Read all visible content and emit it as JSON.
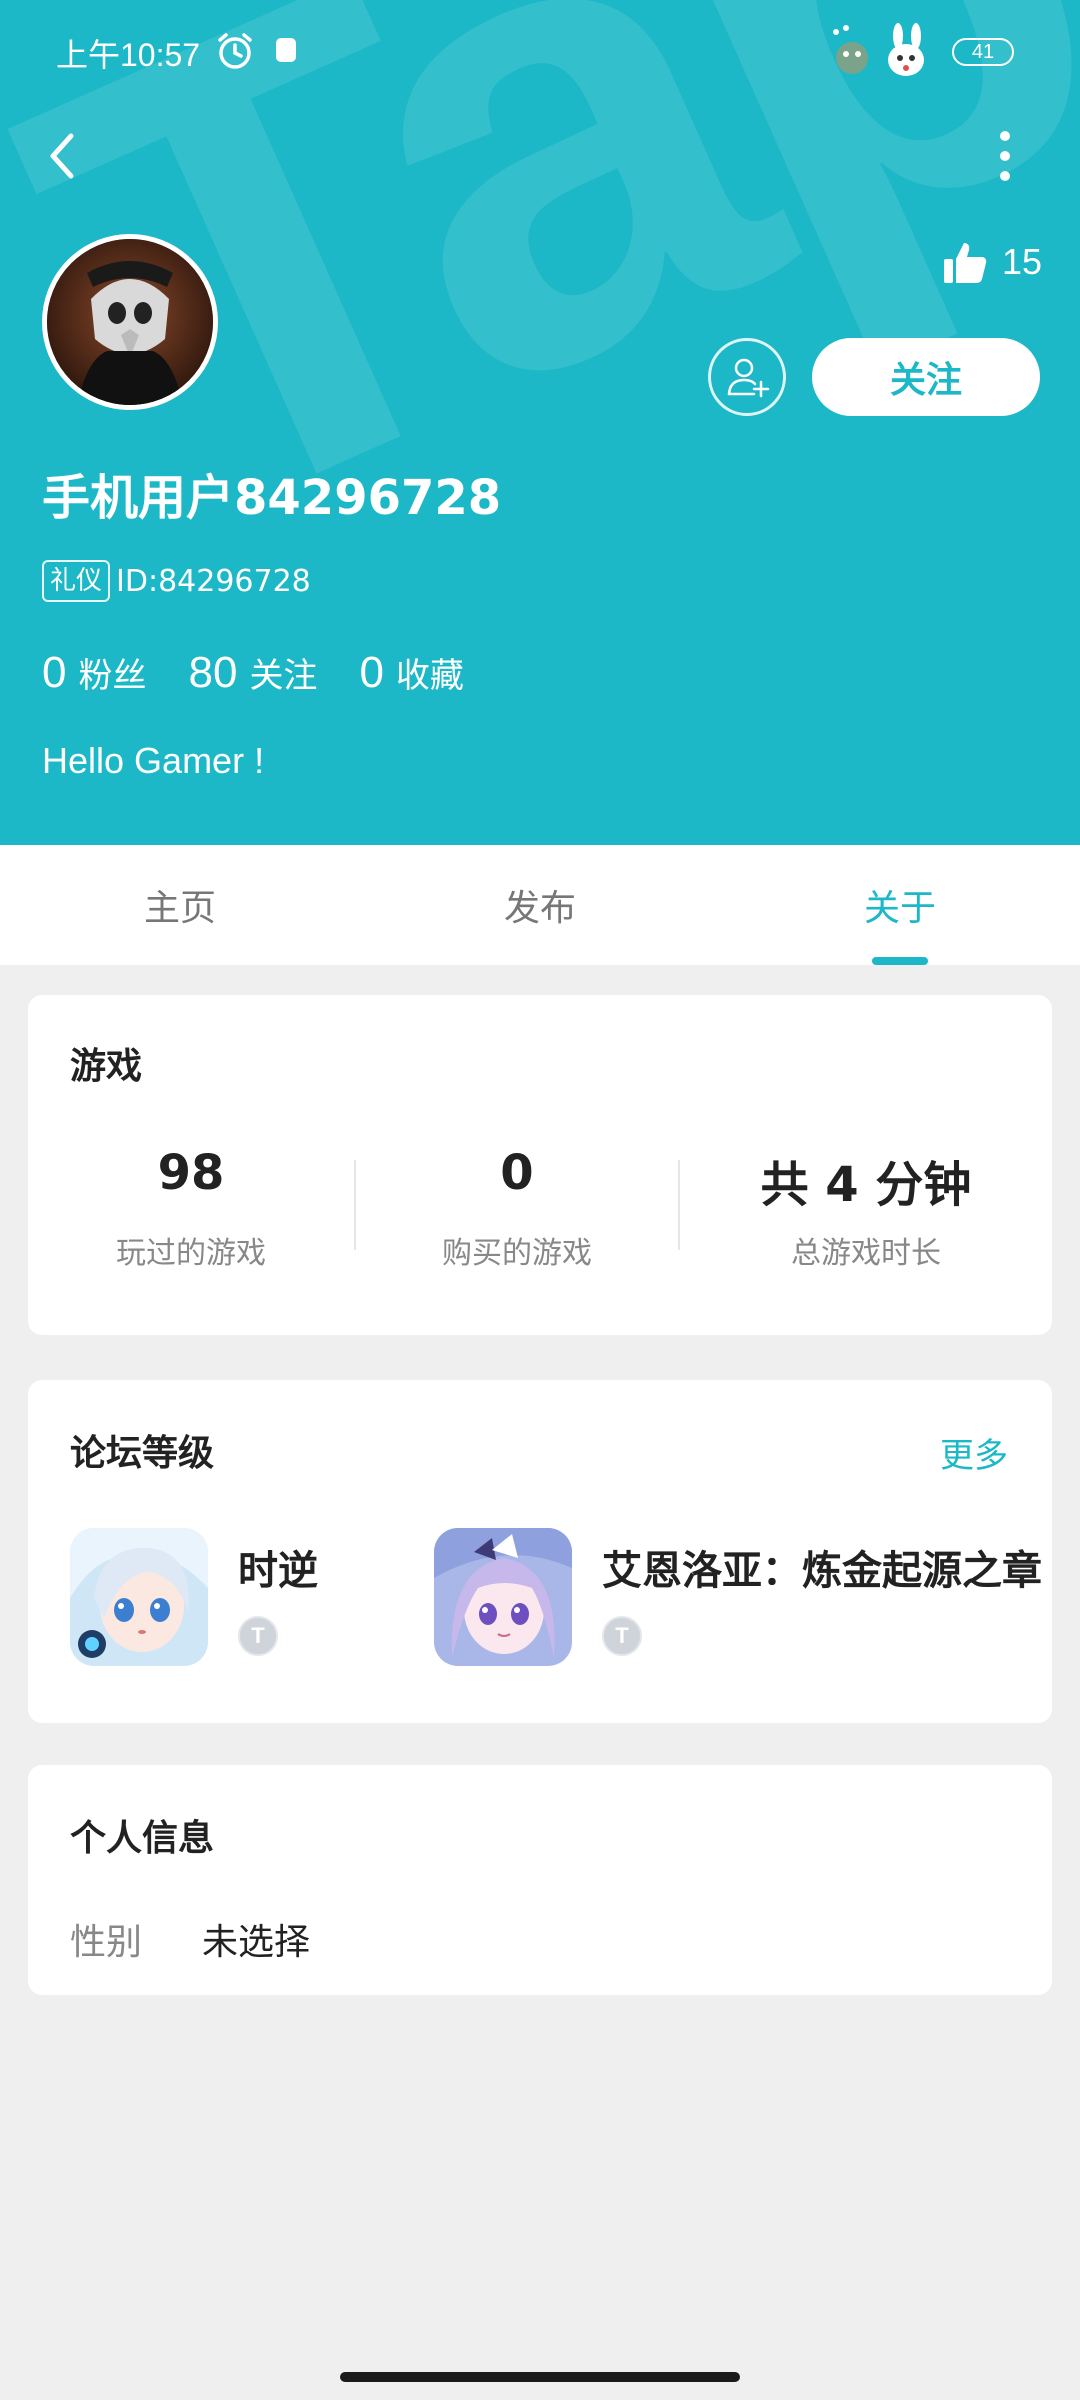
{
  "status_bar": {
    "time": "上午10:57",
    "battery": "41",
    "icons": [
      "alarm-icon",
      "notification-icon",
      "mascot-icon",
      "battery-icon"
    ]
  },
  "theme": {
    "accent": "#1cb8c7",
    "background": "#efefef",
    "card": "#ffffff",
    "text_primary": "#222222",
    "text_secondary": "#888888"
  },
  "header": {
    "watermark": "TapTap",
    "likes": "15",
    "follow_label": "关注",
    "username": "手机用户84296728",
    "etiquette_badge": "礼仪",
    "user_id": "ID:84296728",
    "stats": [
      {
        "value": "0",
        "label": "粉丝"
      },
      {
        "value": "80",
        "label": "关注"
      },
      {
        "value": "0",
        "label": "收藏"
      }
    ],
    "bio": "Hello Gamer !"
  },
  "tabs": [
    {
      "label": "主页",
      "active": false
    },
    {
      "label": "发布",
      "active": false
    },
    {
      "label": "关于",
      "active": true
    }
  ],
  "games_card": {
    "title": "游戏",
    "stats": [
      {
        "value": "98",
        "label": "玩过的游戏"
      },
      {
        "value": "0",
        "label": "购买的游戏"
      },
      {
        "value": "共 4 分钟",
        "label": "总游戏时长"
      }
    ]
  },
  "forum_card": {
    "title": "论坛等级",
    "more_label": "更多",
    "games": [
      {
        "name": "时逆",
        "level_badge": "T"
      },
      {
        "name": "艾恩洛亚：炼金起源之章",
        "level_badge": "T"
      }
    ]
  },
  "info_card": {
    "title": "个人信息",
    "gender_label": "性别",
    "gender_value": "未选择"
  }
}
